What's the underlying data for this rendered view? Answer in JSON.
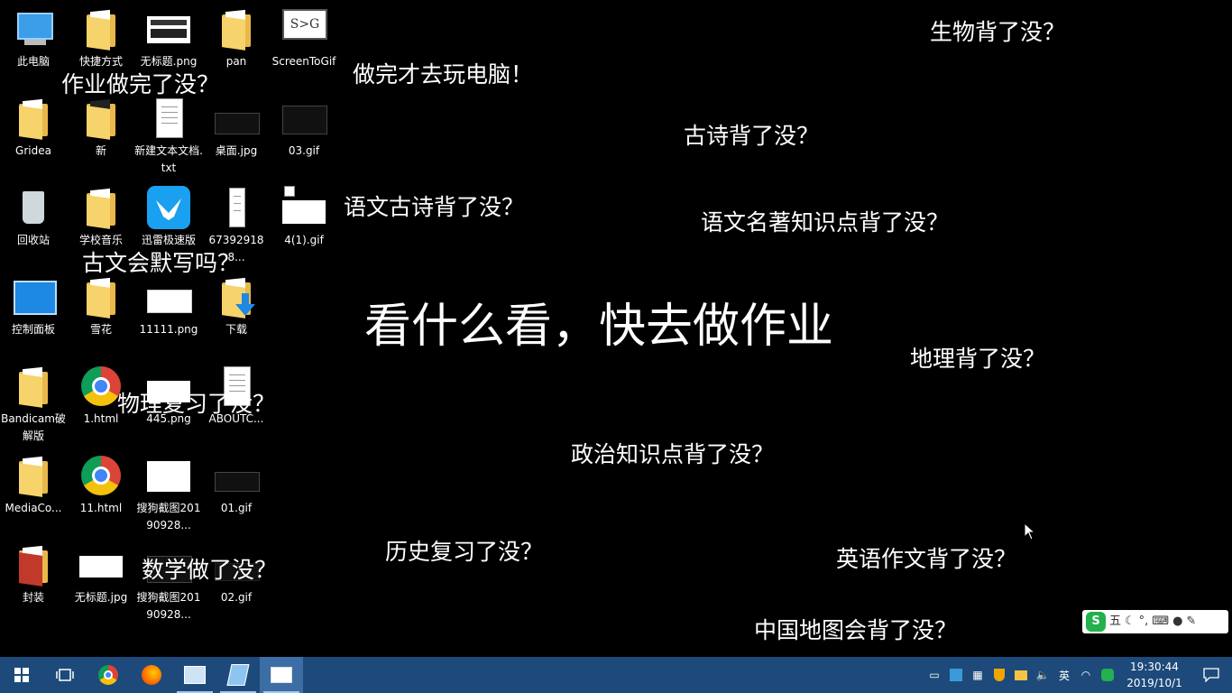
{
  "desktop": {
    "icons": [
      {
        "label": "此电脑"
      },
      {
        "label": "快捷方式"
      },
      {
        "label": "无标题.png"
      },
      {
        "label": "pan"
      },
      {
        "label": "ScreenToGif"
      },
      {
        "label": "Gridea"
      },
      {
        "label": "新"
      },
      {
        "label": "新建文本文档.txt"
      },
      {
        "label": "桌面.jpg"
      },
      {
        "label": "03.gif"
      },
      {
        "label": "回收站"
      },
      {
        "label": "学校音乐"
      },
      {
        "label": "迅雷极速版"
      },
      {
        "label": "673929188..."
      },
      {
        "label": "4(1).gif"
      },
      {
        "label": "控制面板"
      },
      {
        "label": "雪花"
      },
      {
        "label": "11111.png"
      },
      {
        "label": "下载"
      },
      {
        "label": "Bandicam破解版"
      },
      {
        "label": "1.html"
      },
      {
        "label": "445.png"
      },
      {
        "label": "ABOUTC..."
      },
      {
        "label": "MediaCo..."
      },
      {
        "label": "11.html"
      },
      {
        "label": "搜狗截图20190928..."
      },
      {
        "label": "01.gif"
      },
      {
        "label": "封装"
      },
      {
        "label": "无标题.jpg"
      },
      {
        "label": "搜狗截图20190928..."
      },
      {
        "label": "02.gif"
      }
    ],
    "screentogif_glyph": "S>G"
  },
  "messages": {
    "main": "看什么看，快去做作业",
    "homework": "作业做完了没？",
    "finish_first": "做完才去玩电脑！",
    "biology": "生物背了没？",
    "poems": "古诗背了没？",
    "chinese_poems": "语文古诗背了没？",
    "classics": "语文名著知识点背了没？",
    "classical_text": "古文会默写吗？",
    "geography": "地理背了没？",
    "physics": "物理复习了没？",
    "politics": "政治知识点背了没？",
    "history": "历史复习了没？",
    "math": "数学做了没？",
    "english": "英语作文背了没？",
    "china_map": "中国地图会背了没？"
  },
  "ime": {
    "logo": "S",
    "mode": "五"
  },
  "taskbar": {
    "clock_time": "19:30:44",
    "clock_date": "2019/10/1",
    "tray_lang": "英"
  }
}
